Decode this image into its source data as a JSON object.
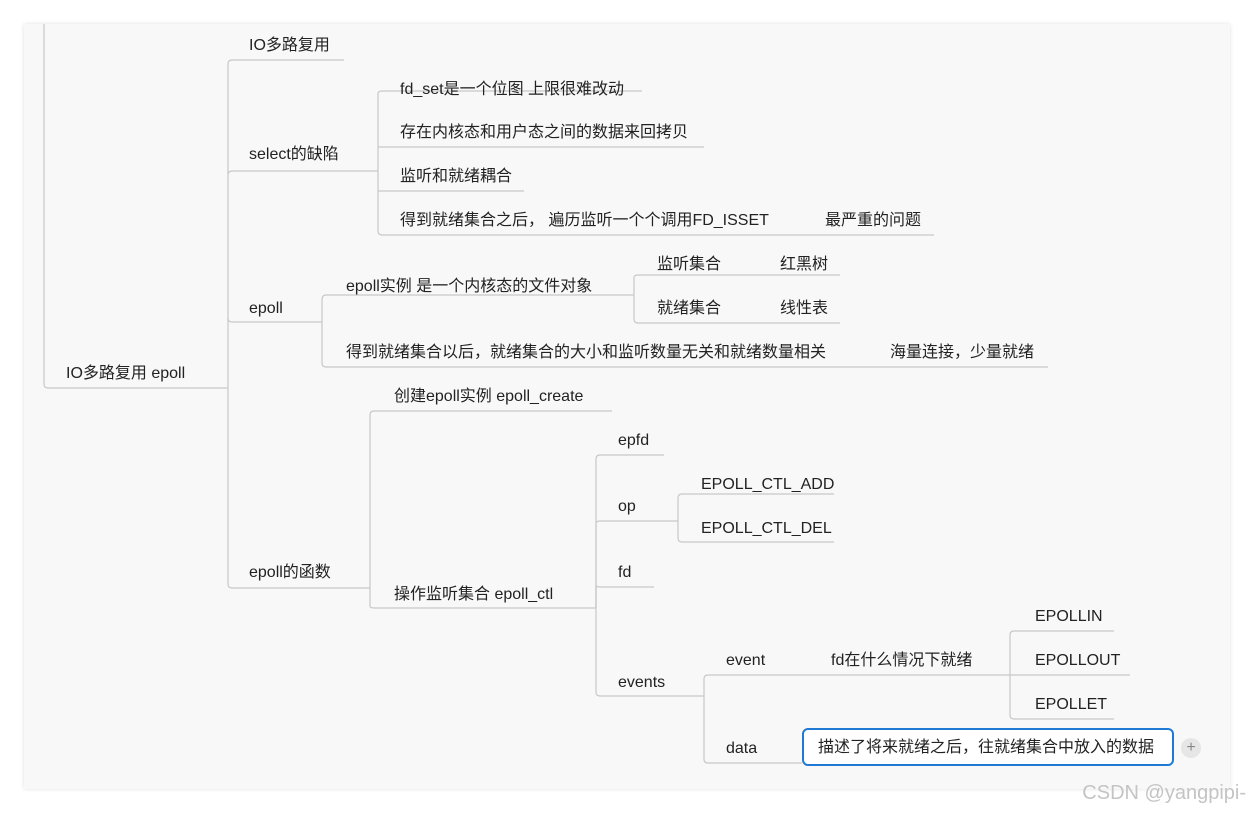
{
  "nodes": {
    "root": "IO多路复用 epoll",
    "io": "IO多路复用",
    "select": "select的缺陷",
    "select_1": "fd_set是一个位图 上限很难改动",
    "select_2": "存在内核态和用户态之间的数据来回拷贝",
    "select_3": "监听和就绪耦合",
    "select_4": "得到就绪集合之后， 遍历监听一个个调用FD_ISSET",
    "select_4_note": "最严重的问题",
    "epoll": "epoll",
    "epoll_inst": "epoll实例 是一个内核态的文件对象",
    "listen_set": "监听集合",
    "rb_tree": "红黑树",
    "ready_set": "就绪集合",
    "linear": "线性表",
    "epoll_ready": "得到就绪集合以后，就绪集合的大小和监听数量无关和就绪数量相关",
    "epoll_ready_note": "海量连接，少量就绪",
    "funcs": "epoll的函数",
    "create": "创建epoll实例  epoll_create",
    "ctl": "操作监听集合 epoll_ctl",
    "epfd": "epfd",
    "op": "op",
    "ctl_add": "EPOLL_CTL_ADD",
    "ctl_del": "EPOLL_CTL_DEL",
    "fd": "fd",
    "events": "events",
    "event": "event",
    "event_desc": "fd在什么情况下就绪",
    "epollin": "EPOLLIN",
    "epollout": "EPOLLOUT",
    "epollet": "EPOLLET",
    "data": "data",
    "data_desc": "描述了将来就绪之后，往就绪集合中放入的数据"
  },
  "add_button": "+",
  "watermark": "CSDN @yangpipi-",
  "colors": {
    "selection": "#1f7ad6",
    "line": "#c8c8c8",
    "text": "#222222"
  }
}
